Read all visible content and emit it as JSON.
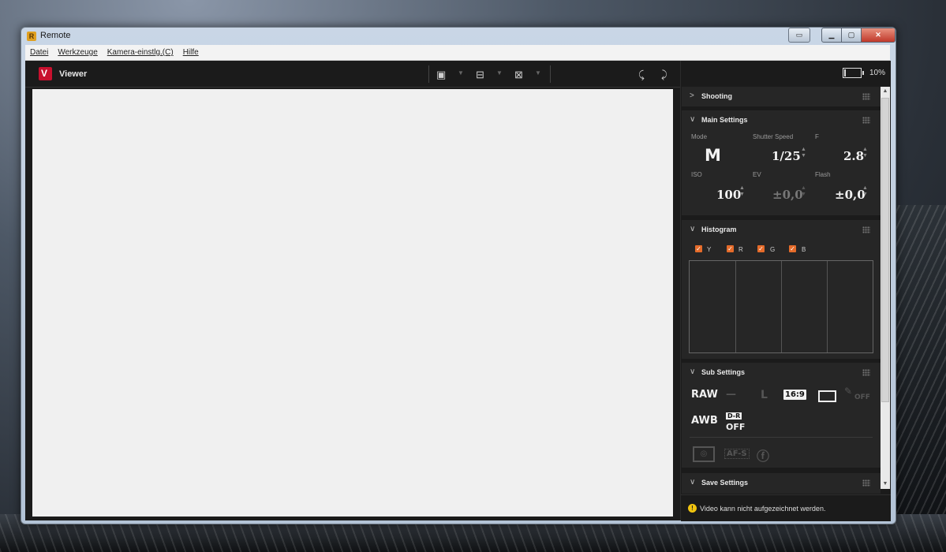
{
  "window": {
    "title": "Remote",
    "app_icon_letter": "R"
  },
  "menu": [
    {
      "label": "Datei"
    },
    {
      "label": "Werkzeuge"
    },
    {
      "label": "Kamera-einstlg.(C)"
    },
    {
      "label": "Hilfe"
    }
  ],
  "viewer": {
    "title": "Viewer",
    "logo_letter": "V"
  },
  "battery": {
    "label": "10%",
    "level": 0.1
  },
  "sections": {
    "shooting": {
      "title": "Shooting"
    },
    "main_settings": {
      "title": "Main Settings",
      "mode_label": "Mode",
      "mode_value": "M",
      "shutter_label": "Shutter Speed",
      "shutter_value": "1/25",
      "f_label": "F",
      "f_value": "2.8",
      "iso_label": "ISO",
      "iso_value": "100",
      "ev_label": "EV",
      "ev_value": "±0,0",
      "flash_label": "Flash",
      "flash_value": "±0,0"
    },
    "histogram": {
      "title": "Histogram",
      "channels": [
        {
          "label": "Y",
          "checked": true
        },
        {
          "label": "R",
          "checked": true
        },
        {
          "label": "G",
          "checked": true
        },
        {
          "label": "B",
          "checked": true
        }
      ]
    },
    "sub_settings": {
      "title": "Sub Settings",
      "file_format": "RAW",
      "quality": "—",
      "image_size": "L",
      "aspect": "16:9",
      "white_balance": "AWB",
      "dr_top": "D-R",
      "dr_bottom": "OFF",
      "af_mode": "AF-S",
      "off_badge": "OFF"
    },
    "save_settings": {
      "title": "Save Settings"
    }
  },
  "status": {
    "message": "Video kann nicht aufgezeichnet werden."
  },
  "colors": {
    "accent_checkbox": "#e56b2a",
    "panel_bg": "#262626",
    "warning": "#f1c40f"
  }
}
